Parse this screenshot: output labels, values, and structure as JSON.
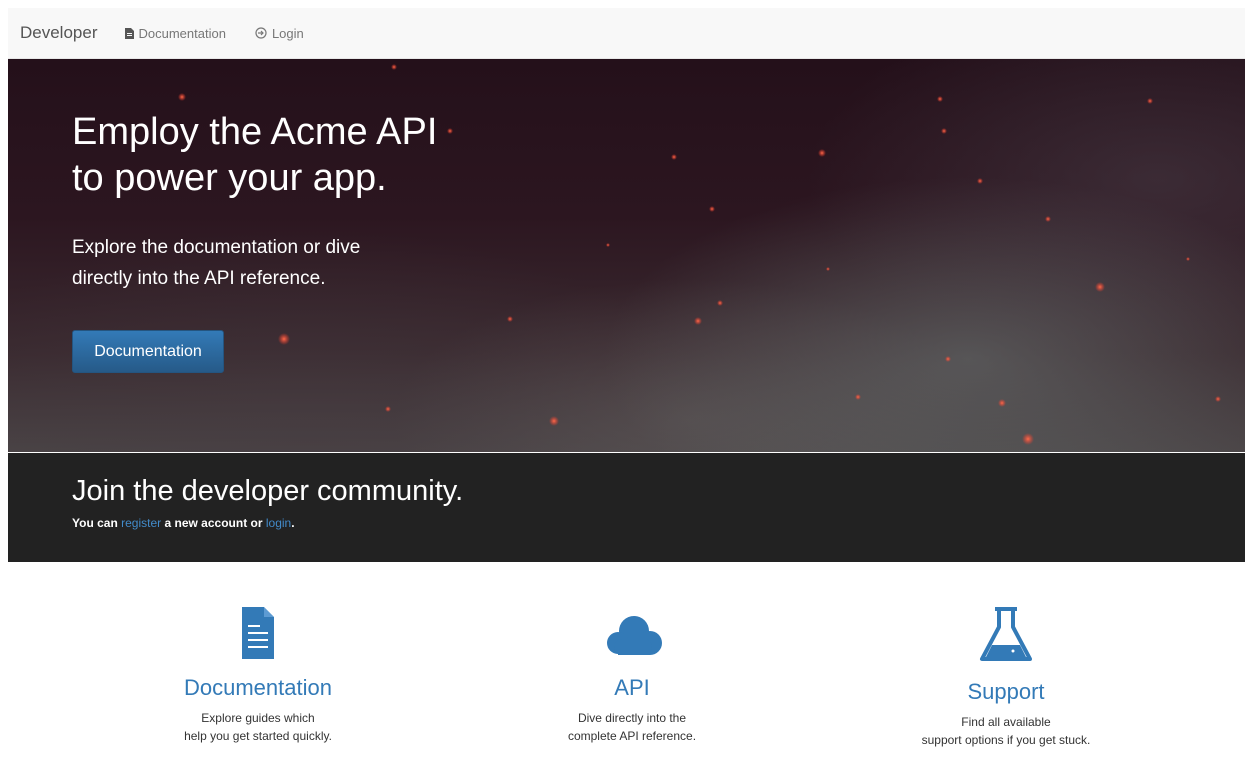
{
  "navbar": {
    "brand": "Developer",
    "links": [
      {
        "label": "Documentation",
        "icon": "file-icon"
      },
      {
        "label": "Login",
        "icon": "login-icon"
      }
    ]
  },
  "hero": {
    "title_line1": "Employ the Acme API",
    "title_line2": "to power your app.",
    "lead_line1": "Explore the documentation or dive",
    "lead_line2": "directly into the API reference.",
    "button_label": "Documentation"
  },
  "community": {
    "title": "Join the developer community.",
    "text_prefix": "You can",
    "register_link": "register",
    "text_middle": "a new account or",
    "login_link": "login",
    "text_suffix": "."
  },
  "features": [
    {
      "icon": "document-icon",
      "title": "Documentation",
      "desc_line1": "Explore guides which",
      "desc_line2": "help you get started quickly."
    },
    {
      "icon": "cloud-icon",
      "title": "API",
      "desc_line1": "Dive directly into the",
      "desc_line2": "complete API reference."
    },
    {
      "icon": "flask-icon",
      "title": "Support",
      "desc_line1": "Find all available",
      "desc_line2": "support options if you get stuck."
    }
  ],
  "colors": {
    "accent": "#337ab7",
    "navbar_bg": "#f8f8f8",
    "community_bg": "#222222"
  }
}
